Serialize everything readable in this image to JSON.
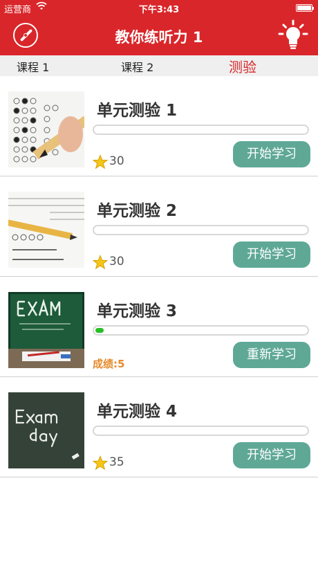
{
  "status_bar": {
    "carrier": "运营商",
    "time": "下午3:43"
  },
  "nav": {
    "title": "教你练听力 1",
    "left_icon": "compass-icon",
    "right_icon": "lightbulb-icon"
  },
  "tabs": [
    {
      "label": "课程 1",
      "active": false
    },
    {
      "label": "课程 2",
      "active": false
    },
    {
      "label": "测验",
      "active": true
    }
  ],
  "colors": {
    "brand_red": "#d9262a",
    "button_teal": "#5fa896",
    "progress_green": "#25c025",
    "grade_orange": "#e58a2c"
  },
  "items": [
    {
      "name": "单元测验 1",
      "progress": 0,
      "stars": "30",
      "button": "开始学习",
      "thumb": "answer-sheet-pencil"
    },
    {
      "name": "单元测验 2",
      "progress": 0,
      "stars": "30",
      "button": "开始学习",
      "thumb": "booklet-pencil"
    },
    {
      "name": "单元测验 3",
      "progress": 0.04,
      "grade": "成绩:5",
      "button": "重新学习",
      "thumb": "exam-chalkboard-green"
    },
    {
      "name": "单元测验 4",
      "progress": 0,
      "stars": "35",
      "button": "开始学习",
      "thumb": "exam-day-chalkboard"
    }
  ]
}
